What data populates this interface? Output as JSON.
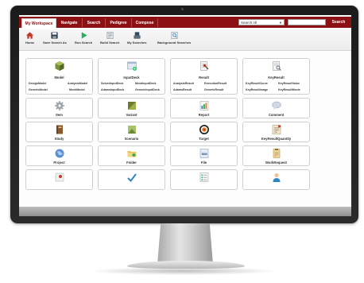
{
  "nav": {
    "tabs": [
      "My Workspace",
      "Navigate",
      "Search",
      "Pedigree",
      "Compose"
    ],
    "search_scope": "Search All",
    "search_button": "Search"
  },
  "toolbar": {
    "items": [
      "Home",
      "Save Search As",
      "Run Search",
      "Build Search",
      "My Searches",
      "Background Searches"
    ]
  },
  "cards": {
    "model": {
      "title": "Model",
      "subs": [
        "DesignModel",
        "AnalysisModel",
        "GenericModel",
        "MeshModel"
      ]
    },
    "input_deck": {
      "title": "InputDeck",
      "subs": [
        "SolverInputDeck",
        "MeshInputDeck",
        "AdamsInputDeck",
        "GenericInputDeck"
      ]
    },
    "result": {
      "title": "Result",
      "subs": [
        "AnalysisResult",
        "ExecutionResult",
        "AdamsResult",
        "GenericResult"
      ]
    },
    "key_result": {
      "title": "KeyResult",
      "subs": [
        "KeyResultCurve",
        "KeyResultValue",
        "KeyResultImage",
        "KeyResultMovie"
      ]
    },
    "item": {
      "title": "Item"
    },
    "variant": {
      "title": "Variant"
    },
    "report": {
      "title": "Report"
    },
    "comment": {
      "title": "Comment"
    },
    "study": {
      "title": "Study"
    },
    "scenario": {
      "title": "Scenario"
    },
    "target": {
      "title": "Target"
    },
    "key_result_quantity": {
      "title": "KeyResultQuantity"
    },
    "project": {
      "title": "Project"
    },
    "folder": {
      "title": "Folder"
    },
    "file": {
      "title": "File",
      "icon_text": "SIM"
    },
    "work_request": {
      "title": "WorkRequest"
    }
  }
}
